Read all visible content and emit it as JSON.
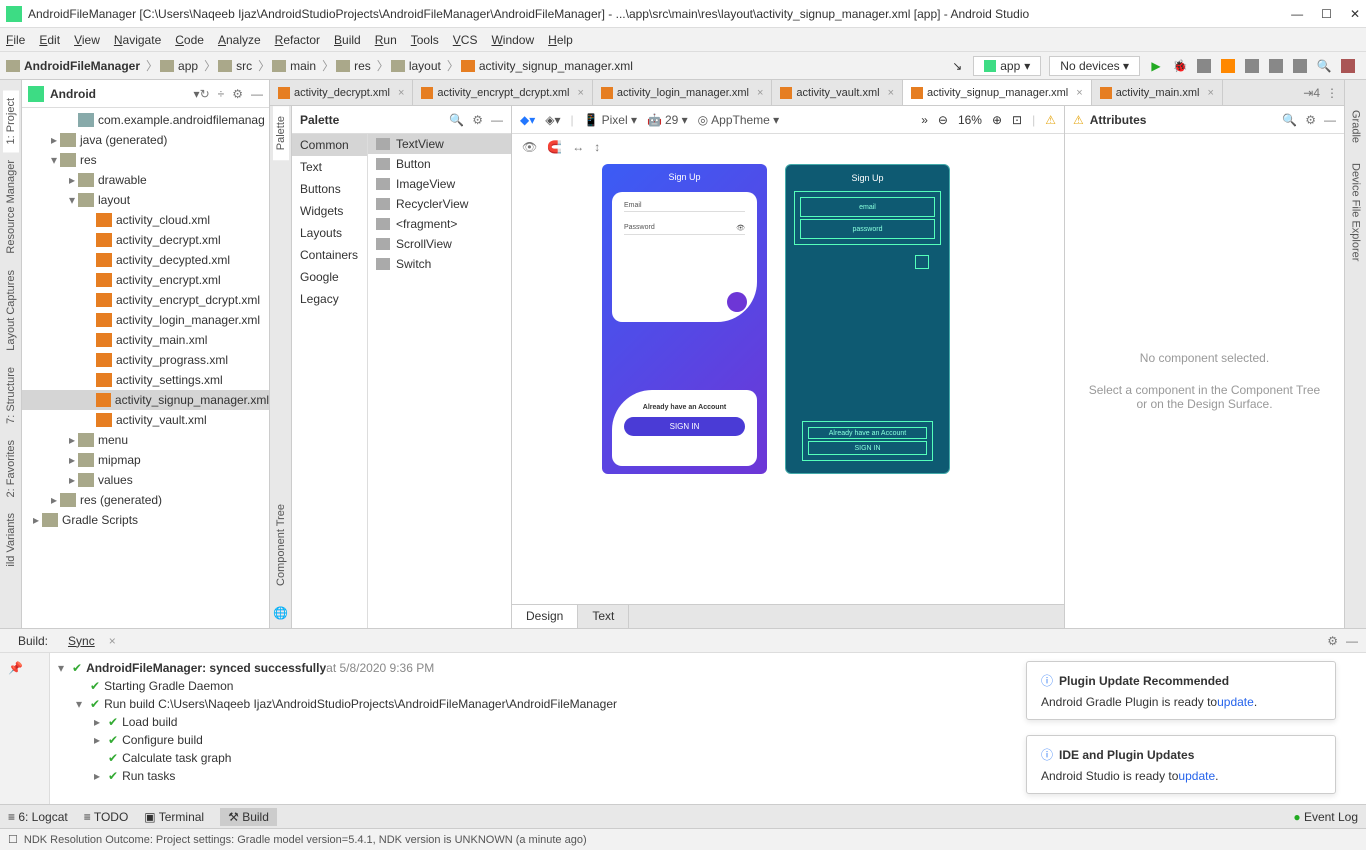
{
  "window": {
    "title": "AndroidFileManager [C:\\Users\\Naqeeb Ijaz\\AndroidStudioProjects\\AndroidFileManager\\AndroidFileManager] - ...\\app\\src\\main\\res\\layout\\activity_signup_manager.xml [app] - Android Studio"
  },
  "menu": [
    "File",
    "Edit",
    "View",
    "Navigate",
    "Code",
    "Analyze",
    "Refactor",
    "Build",
    "Run",
    "Tools",
    "VCS",
    "Window",
    "Help"
  ],
  "breadcrumbs": [
    "AndroidFileManager",
    "app",
    "src",
    "main",
    "res",
    "layout",
    "activity_signup_manager.xml"
  ],
  "run": {
    "config": "app",
    "device": "No devices ▾"
  },
  "left_tabs": [
    "1: Project",
    "Resource Manager",
    "Layout Captures",
    "7: Structure",
    "2: Favorites",
    "ild Variants"
  ],
  "project": {
    "title": "Android",
    "items": [
      {
        "indent": 2,
        "caret": "",
        "icon": "pkg",
        "label": "com.example.androidfilemanag"
      },
      {
        "indent": 1,
        "caret": "▸",
        "icon": "folder",
        "label": "java (generated)"
      },
      {
        "indent": 1,
        "caret": "▾",
        "icon": "folder",
        "label": "res"
      },
      {
        "indent": 2,
        "caret": "▸",
        "icon": "folder",
        "label": "drawable"
      },
      {
        "indent": 2,
        "caret": "▾",
        "icon": "folder",
        "label": "layout"
      },
      {
        "indent": 3,
        "caret": "",
        "icon": "xml",
        "label": "activity_cloud.xml"
      },
      {
        "indent": 3,
        "caret": "",
        "icon": "xml",
        "label": "activity_decrypt.xml"
      },
      {
        "indent": 3,
        "caret": "",
        "icon": "xml",
        "label": "activity_decypted.xml"
      },
      {
        "indent": 3,
        "caret": "",
        "icon": "xml",
        "label": "activity_encrypt.xml"
      },
      {
        "indent": 3,
        "caret": "",
        "icon": "xml",
        "label": "activity_encrypt_dcrypt.xml"
      },
      {
        "indent": 3,
        "caret": "",
        "icon": "xml",
        "label": "activity_login_manager.xml"
      },
      {
        "indent": 3,
        "caret": "",
        "icon": "xml",
        "label": "activity_main.xml"
      },
      {
        "indent": 3,
        "caret": "",
        "icon": "xml",
        "label": "activity_prograss.xml"
      },
      {
        "indent": 3,
        "caret": "",
        "icon": "xml",
        "label": "activity_settings.xml"
      },
      {
        "indent": 3,
        "caret": "",
        "icon": "xml",
        "label": "activity_signup_manager.xml",
        "selected": true
      },
      {
        "indent": 3,
        "caret": "",
        "icon": "xml",
        "label": "activity_vault.xml"
      },
      {
        "indent": 2,
        "caret": "▸",
        "icon": "folder",
        "label": "menu"
      },
      {
        "indent": 2,
        "caret": "▸",
        "icon": "folder",
        "label": "mipmap"
      },
      {
        "indent": 2,
        "caret": "▸",
        "icon": "folder",
        "label": "values"
      },
      {
        "indent": 1,
        "caret": "▸",
        "icon": "folder",
        "label": "res (generated)"
      },
      {
        "indent": 0,
        "caret": "▸",
        "icon": "folder",
        "label": "Gradle Scripts"
      }
    ]
  },
  "file_tabs": [
    {
      "label": "activity_decrypt.xml"
    },
    {
      "label": "activity_encrypt_dcrypt.xml"
    },
    {
      "label": "activity_login_manager.xml"
    },
    {
      "label": "activity_vault.xml"
    },
    {
      "label": "activity_signup_manager.xml",
      "active": true
    },
    {
      "label": "activity_main.xml"
    }
  ],
  "palette": {
    "title": "Palette",
    "vtab1": "Palette",
    "vtab2": "Component Tree",
    "categories": [
      "Common",
      "Text",
      "Buttons",
      "Widgets",
      "Layouts",
      "Containers",
      "Google",
      "Legacy"
    ],
    "selected_cat": "Common",
    "items": [
      "TextView",
      "Button",
      "ImageView",
      "RecyclerView",
      "<fragment>",
      "ScrollView",
      "Switch"
    ],
    "selected_item": "TextView"
  },
  "design_toolbar": {
    "device": "Pixel ▾",
    "api": "29 ▾",
    "theme": "AppTheme ▾",
    "zoom": "16%"
  },
  "preview": {
    "signup": "Sign Up",
    "email": "Email",
    "password": "Password",
    "already": "Already have an Account",
    "signin": "SIGN IN",
    "bp_email": "email",
    "bp_password": "password",
    "bp_already": "Already have an Account",
    "bp_signin": "SIGN IN"
  },
  "design_tabs": {
    "design": "Design",
    "text": "Text"
  },
  "attributes": {
    "title": "Attributes",
    "empty1": "No component selected.",
    "empty2": "Select a component in the Component Tree or on the Design Surface."
  },
  "right_tabs": [
    "Gradle",
    "Device File Explorer"
  ],
  "build": {
    "tab1": "Build:",
    "tab2": "Sync",
    "lines": [
      {
        "indent": 0,
        "caret": "▾",
        "chk": true,
        "bold": true,
        "text": "AndroidFileManager: synced successfully",
        "suffix": " at 5/8/2020 9:36 PM"
      },
      {
        "indent": 1,
        "caret": "",
        "chk": true,
        "text": "Starting Gradle Daemon"
      },
      {
        "indent": 1,
        "caret": "▾",
        "chk": true,
        "text": "Run build C:\\Users\\Naqeeb Ijaz\\AndroidStudioProjects\\AndroidFileManager\\AndroidFileManager"
      },
      {
        "indent": 2,
        "caret": "▸",
        "chk": true,
        "text": "Load build"
      },
      {
        "indent": 2,
        "caret": "▸",
        "chk": true,
        "text": "Configure build"
      },
      {
        "indent": 2,
        "caret": "",
        "chk": true,
        "text": "Calculate task graph"
      },
      {
        "indent": 2,
        "caret": "▸",
        "chk": true,
        "text": "Run tasks"
      }
    ]
  },
  "notifications": [
    {
      "title": "Plugin Update Recommended",
      "body": "Android Gradle Plugin is ready to ",
      "link": "update"
    },
    {
      "title": "IDE and Plugin Updates",
      "body": "Android Studio is ready to ",
      "link": "update"
    }
  ],
  "bottom_tabs": [
    "6: Logcat",
    "TODO",
    "Terminal",
    "Build"
  ],
  "event_log": "Event Log",
  "status": "NDK Resolution Outcome: Project settings: Gradle model version=5.4.1, NDK version is UNKNOWN (a minute ago)"
}
